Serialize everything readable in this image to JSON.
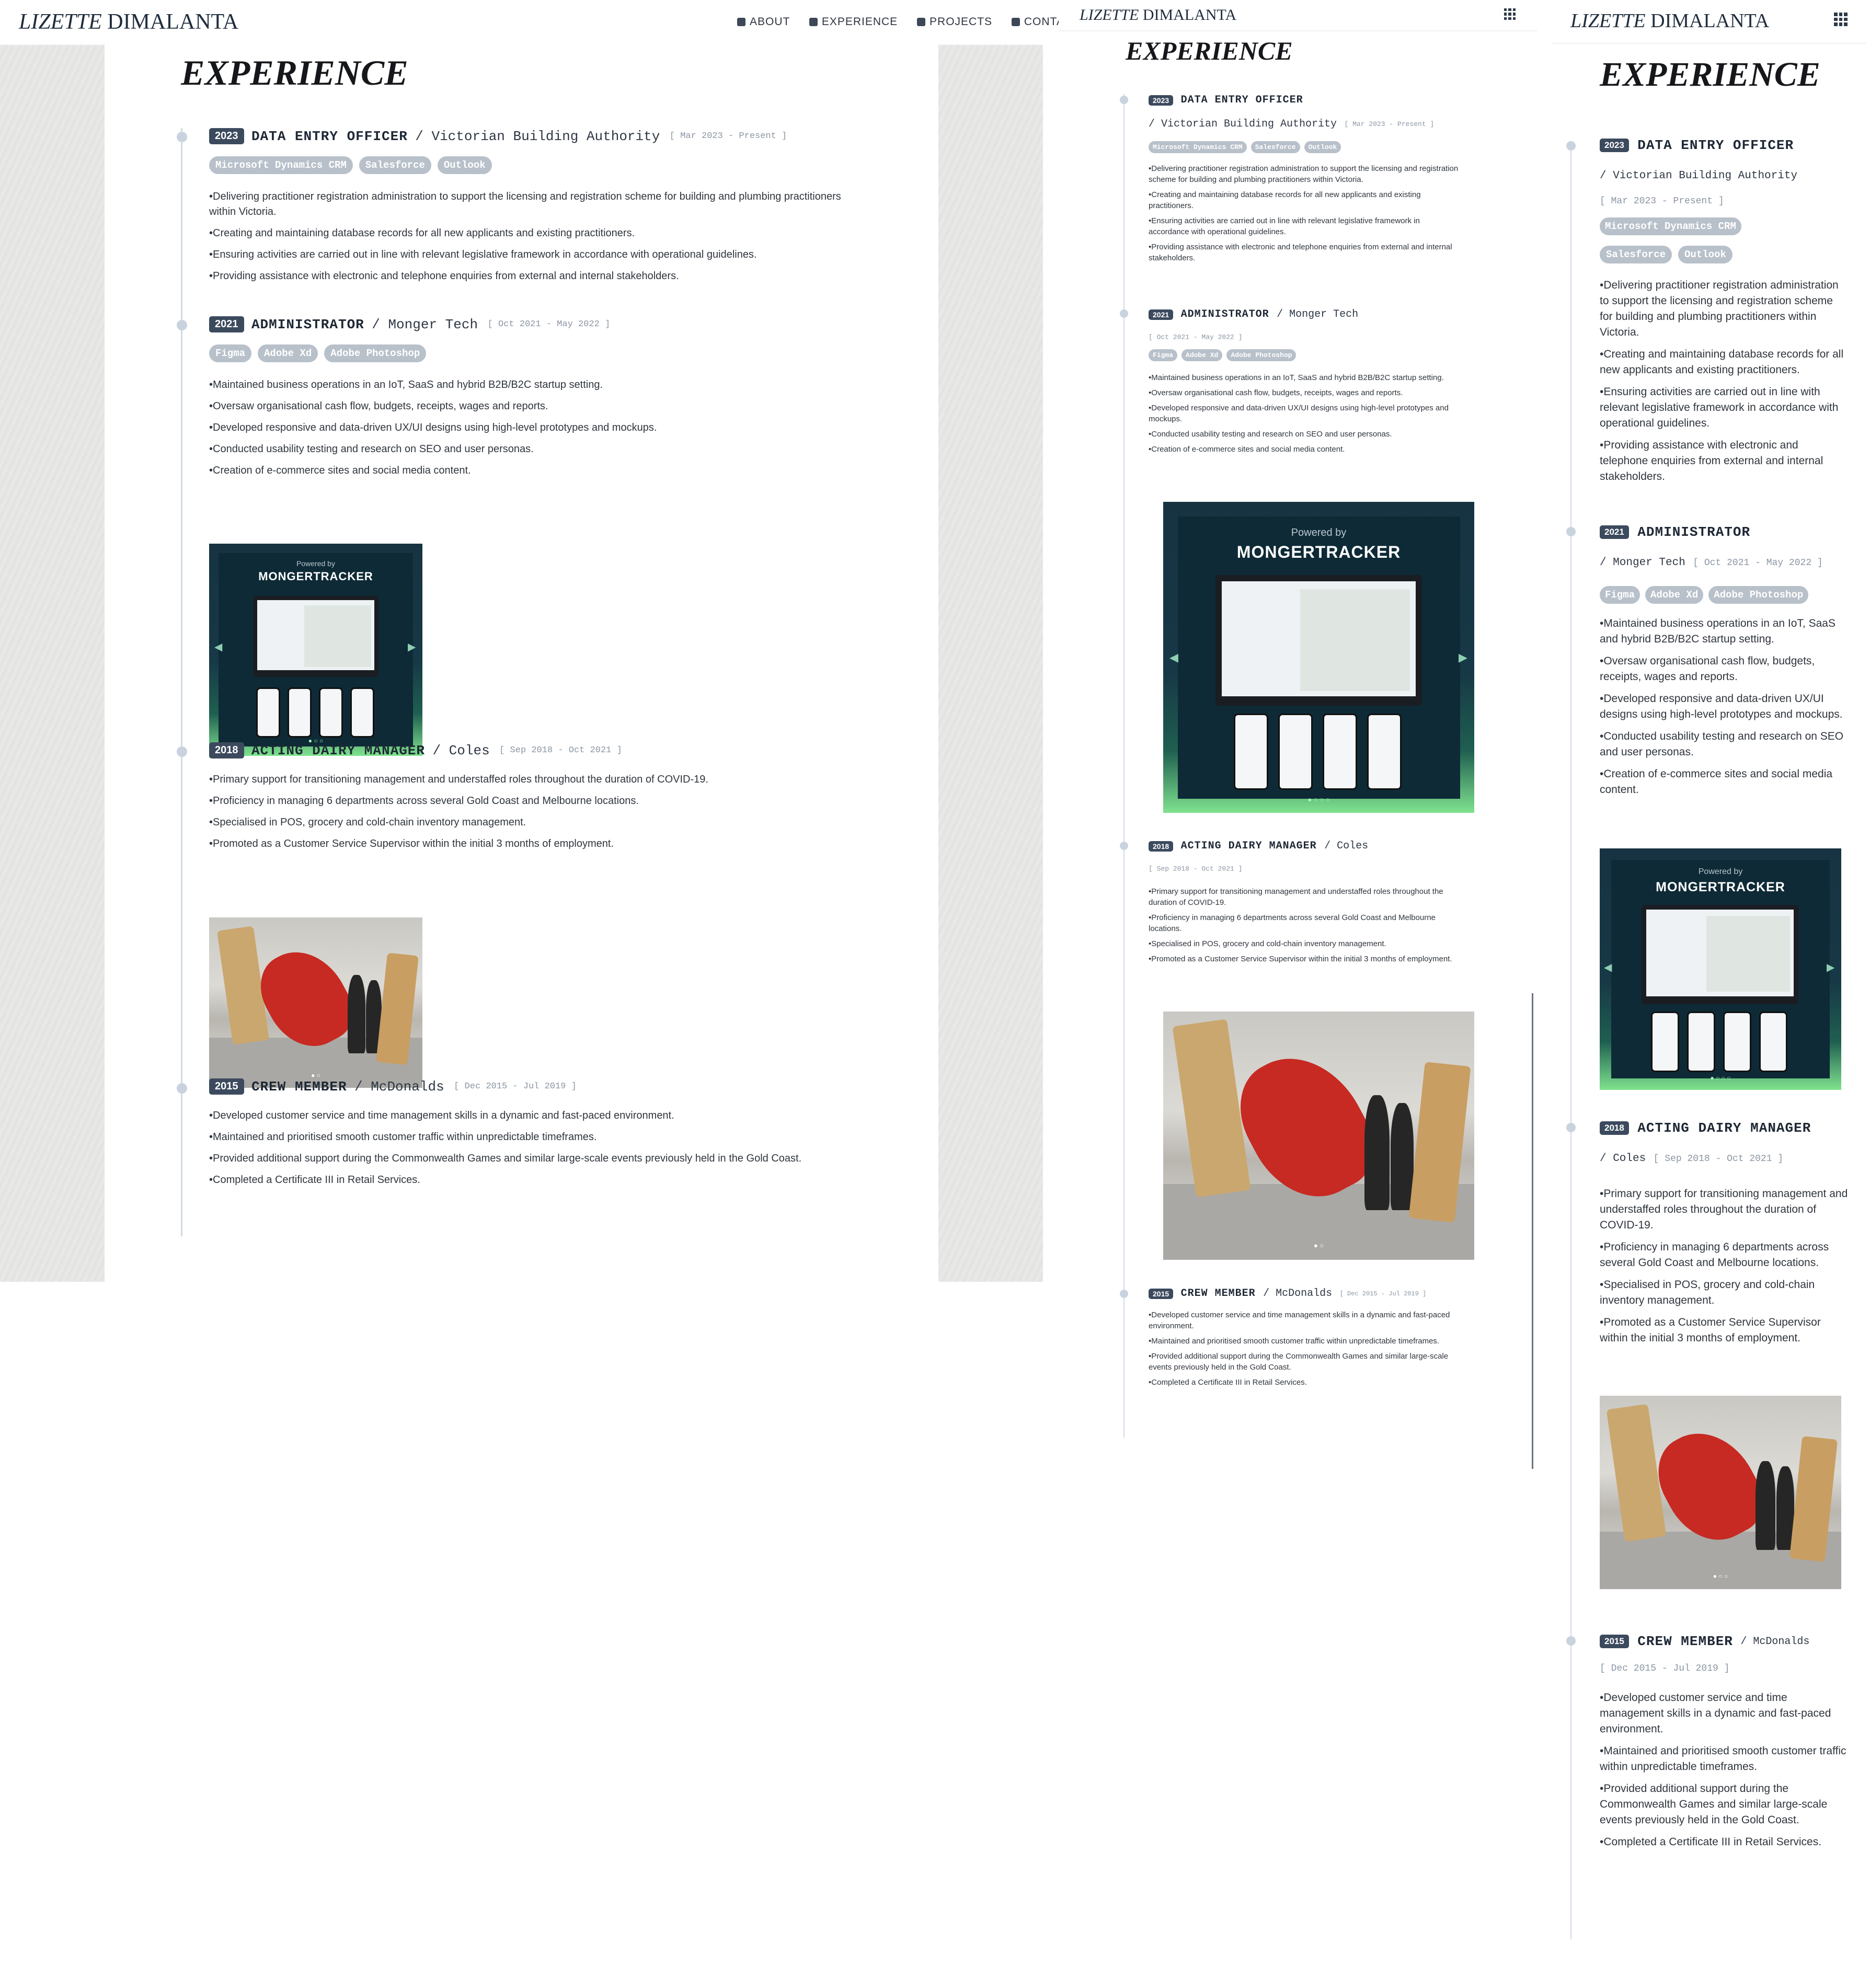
{
  "brand": {
    "first": "LIZETTE",
    "last": "DIMALANTA"
  },
  "nav": [
    {
      "label": "ABOUT",
      "icon": "user-icon"
    },
    {
      "label": "EXPERIENCE",
      "icon": "briefcase-icon"
    },
    {
      "label": "PROJECTS",
      "icon": "code-icon"
    },
    {
      "label": "CONTACT",
      "icon": "contact-book-icon"
    }
  ],
  "menu_icon": "grid-menu-icon",
  "section_title": "EXPERIENCE",
  "entries": [
    {
      "year": "2023",
      "role": "DATA ENTRY OFFICER",
      "company": "/ Victorian Building Authority",
      "dates": "[ Mar 2023 - Present ]",
      "tags": [
        "Microsoft Dynamics CRM",
        "Salesforce",
        "Outlook"
      ],
      "bullets": [
        "Delivering practitioner registration administration to support the licensing and registration scheme for building and plumbing practitioners within Victoria.",
        "Creating and maintaining database records for all new applicants and existing practitioners.",
        "Ensuring activities are carried out in line with relevant legislative framework in accordance with operational guidelines.",
        "Providing assistance with electronic and telephone enquiries from external and internal stakeholders."
      ]
    },
    {
      "year": "2021",
      "role": "ADMINISTRATOR",
      "company": "/ Monger Tech",
      "dates": "[ Oct 2021 - May 2022 ]",
      "tags": [
        "Figma",
        "Adobe Xd",
        "Adobe Photoshop"
      ],
      "bullets": [
        "Maintained business operations in an IoT, SaaS and hybrid B2B/B2C startup setting.",
        "Oversaw organisational cash flow, budgets, receipts, wages and reports.",
        "Developed responsive and data-driven UX/UI designs using high-level prototypes and mockups.",
        "Conducted usability testing and research on SEO and user personas.",
        "Creation of e-commerce sites and social media content."
      ],
      "image": {
        "powered": "Powered by",
        "logo": "MONGERTRACKER"
      }
    },
    {
      "year": "2018",
      "role": "ACTING DAIRY MANAGER",
      "company": "/ Coles",
      "dates": "[ Sep 2018 - Oct 2021 ]",
      "tags": [],
      "bullets": [
        "Primary support for transitioning management and understaffed roles throughout the duration of COVID-19.",
        "Proficiency in managing 6 departments across several Gold Coast and Melbourne locations.",
        "Specialised in POS, grocery and cold-chain inventory management.",
        "Promoted as a Customer Service Supervisor within the initial 3 months of employment."
      ]
    },
    {
      "year": "2015",
      "role": "CREW MEMBER",
      "company": "/ McDonalds",
      "dates": "[ Dec 2015 - Jul 2019 ]",
      "tags": [],
      "bullets": [
        "Developed customer service and time management skills in a dynamic and fast-paced environment.",
        "Maintained and prioritised smooth customer traffic within unpredictable timeframes.",
        "Provided additional support during the Commonwealth Games and similar large-scale events previously held in the Gold Coast.",
        "Completed a Certificate III in Retail Services."
      ]
    }
  ]
}
